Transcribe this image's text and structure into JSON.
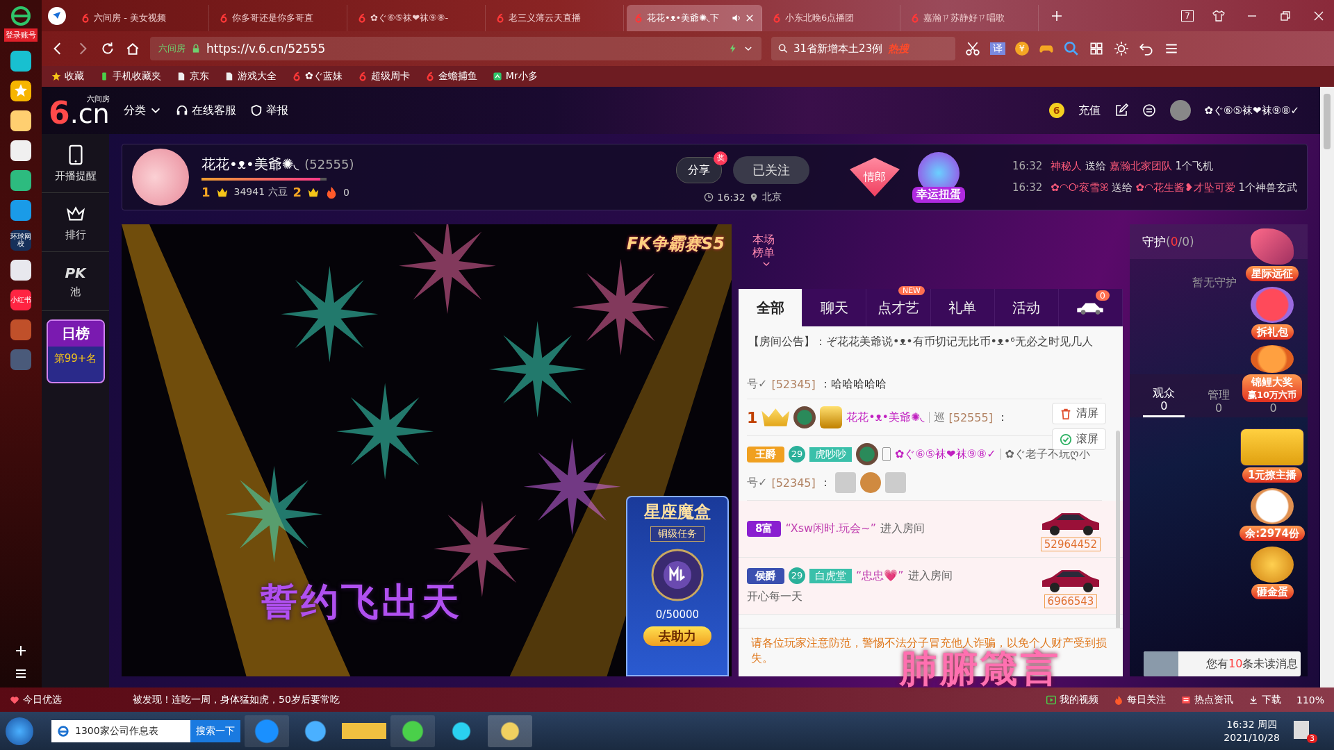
{
  "app_strip": {
    "account": "登录账号",
    "apps": [
      {
        "kind": "clip"
      },
      {
        "kind": "star"
      },
      {
        "kind": "weibo"
      },
      {
        "kind": "mail"
      },
      {
        "kind": "cloud"
      },
      {
        "kind": "p"
      },
      {
        "kind": "school",
        "label": "环球网校"
      },
      {
        "kind": "doc"
      },
      {
        "kind": "red",
        "label": "小红书"
      },
      {
        "kind": "game"
      },
      {
        "kind": "film"
      }
    ]
  },
  "browser": {
    "tabs": [
      {
        "title": "六间房 - 美女视频",
        "selected": false
      },
      {
        "title": "你多哥还是你多哥直",
        "selected": false
      },
      {
        "title": "✿ぐ⑥⑤袜❤袜⑨⑧-",
        "selected": false
      },
      {
        "title": "老三义薄云天直播",
        "selected": false
      },
      {
        "title": "花花•ᴥ•美爺✺◟下",
        "selected": true
      },
      {
        "title": "小东北晚6点播团",
        "selected": false
      },
      {
        "title": "嘉瀚ㄗ苏静好ㄗ唱歌",
        "selected": false
      }
    ],
    "tab_count": "7",
    "site_label": "六间房",
    "url": "https://v.6.cn/52555",
    "search": {
      "value": "31省新增本土23例",
      "badge": "热搜"
    },
    "translate": "译",
    "coupon": "¥",
    "bookmarks": [
      {
        "kind": "star",
        "label": "收藏"
      },
      {
        "kind": "phone",
        "label": "手机收藏夹"
      },
      {
        "kind": "page",
        "label": "京东"
      },
      {
        "kind": "page",
        "label": "游戏大全"
      },
      {
        "kind": "six",
        "label": "✿ぐ蓝妹"
      },
      {
        "kind": "six",
        "label": "超级周卡"
      },
      {
        "kind": "six",
        "label": "金蟾捕鱼"
      },
      {
        "kind": "mr",
        "label": "Mr小多"
      }
    ]
  },
  "header": {
    "logo": ".cn",
    "logo_sub": "六间房",
    "logo_six": "6",
    "menu": [
      {
        "kind": "caret",
        "label": "分类"
      },
      {
        "kind": "service",
        "label": "在线客服"
      },
      {
        "kind": "shield",
        "label": "举报"
      }
    ],
    "coin": "6",
    "recharge": "充值",
    "user": "✿ぐ⑥⑤袜❤袜⑨⑧✓"
  },
  "left_nav": [
    {
      "kind": "phone",
      "label": "开播提醒"
    },
    {
      "kind": "crown",
      "label": "排行"
    },
    {
      "kind": "pk",
      "mark": "PK",
      "label": "池"
    }
  ],
  "daily_rank": {
    "title": "日榜",
    "rank": "第99+名"
  },
  "anchor": {
    "name": "花花•ᴥ•美爺✺◟",
    "id": "(52555)",
    "level": 0.95,
    "rank_from": "1",
    "beans": "34941 六豆",
    "rank_to": "2",
    "fire": "0",
    "share": "分享",
    "share_badge": "奖",
    "follow": "已关注",
    "followed": true,
    "time": "16:32",
    "city": "北京",
    "tag": "情郎",
    "lucky": "幸运扭蛋",
    "gifts": [
      {
        "time": "16:32",
        "sender": "神秘人",
        "verb": "送给",
        "receiver": "嘉瀚北家团队",
        "gift": "1个飞机"
      },
      {
        "time": "16:32",
        "sender": "✿◠Ꭴ衮雪ꕤ",
        "verb": "送给",
        "receiver": "✿◠花生酱❥才坠可爱",
        "gift": "1个神兽玄武"
      }
    ]
  },
  "video": {
    "kind": "picture",
    "logo": "FK争霸赛S5",
    "box": {
      "title": "星座魔盒",
      "task": "铜级任务",
      "progress": "0/50000",
      "action": "去助力"
    }
  },
  "chat": {
    "rank_label": "本场榜单",
    "tabs": [
      {
        "label": "全部",
        "selected": true
      },
      {
        "label": "聊天",
        "selected": false
      },
      {
        "label": "点才艺",
        "selected": false,
        "badge": "NEW"
      },
      {
        "label": "礼单",
        "selected": false
      },
      {
        "label": "活动",
        "selected": false
      },
      {
        "kind": "car",
        "selected": false,
        "badge": "0"
      }
    ],
    "notice_label": "【房间公告】：",
    "notice": "ぞ花花美爺说•ᴥ•有币切记无比币•ᴥ•⁶无必之时见几人",
    "messages": [
      {
        "kind": "chat",
        "name_tail": "号✓",
        "uid": "[52345]",
        "text": "：哈哈哈哈哈"
      },
      {
        "kind": "chat",
        "rank": "1",
        "badges": [
          {
            "kind": "crown"
          },
          {
            "kind": "star"
          },
          {
            "kind": "vip"
          }
        ],
        "name": "花花•ᴥ•美爺✺◟",
        "role": "巡",
        "uid": "[52555]",
        "text": "："
      },
      {
        "kind": "chat",
        "title": {
          "label": "王爵",
          "color": "#f0a020"
        },
        "level": "29",
        "group": "虎吵吵",
        "badges": [
          {
            "kind": "star"
          },
          {
            "kind": "phone"
          }
        ],
        "name": "✿ぐ⑥⑤袜❤袜⑨⑧✓",
        "to": "✿ぐ老子不玩ღ小",
        "name_tail": "号✓",
        "uid": "[52345]",
        "text": "：",
        "emojis": [
          {
            "kind": "face"
          },
          {
            "kind": "coin"
          },
          {
            "kind": "face"
          }
        ]
      },
      {
        "kind": "enter",
        "title": {
          "label": "8富",
          "color": "#8a1fd0"
        },
        "who": "“Xsw闲时.玩会~”",
        "action": "进入房间",
        "car_id": "52964452"
      },
      {
        "kind": "enter",
        "title": {
          "label": "侯爵",
          "color": "#3a4fb0"
        },
        "level": "29",
        "group": "白虎堂",
        "who": "“忠忠💗”",
        "action": "进入房间",
        "note": "开心每一天",
        "car_id": "6966543"
      }
    ],
    "clear": "清屏",
    "scroll": "滚屏",
    "warning": "请各位玩家注意防范，警惕不法分子冒充他人诈骗，以免个人财产受到损失。"
  },
  "side": {
    "guard": "守护",
    "guard_open": "(",
    "guard_count": "0",
    "guard_total": "/0)",
    "guard_empty": "暂无守护",
    "tabs": [
      {
        "label": "观众",
        "count": "0",
        "selected": true
      },
      {
        "label": "管理",
        "count": "0",
        "selected": false
      },
      {
        "count": "0",
        "selected": false
      }
    ],
    "promos": [
      {
        "kind": "rocket",
        "label": "星际远征"
      },
      {
        "kind": "gift",
        "label": "拆礼包"
      },
      {
        "kind": "fish",
        "label": "锦鲤大奖",
        "sub": "赢10万六币"
      },
      {
        "kind": "card",
        "label": "1元撩主播"
      },
      {
        "kind": "cat",
        "label": "余:2974份"
      },
      {
        "kind": "egg",
        "label": "砸金蛋"
      }
    ],
    "unread_pre": "您有",
    "unread_count": "10",
    "unread_post": "条未读消息"
  },
  "lyrics": [
    "誓约飞出天",
    "肺腑箴言"
  ],
  "status_bar": {
    "pick": "今日优选",
    "news": "被发现！连吃一周，身体猛如虎，50岁后要常吃",
    "links": [
      {
        "kind": "video",
        "label": "我的视频"
      },
      {
        "kind": "fire",
        "label": "每日关注"
      },
      {
        "kind": "news",
        "label": "热点资讯"
      },
      {
        "kind": "download",
        "label": "下载"
      }
    ],
    "zoom": "110%"
  },
  "taskbar": {
    "search": "1300家公司作息表",
    "search_button": "搜索一下",
    "time": "16:32 周四",
    "date": "2021/10/28",
    "badge": "3"
  }
}
